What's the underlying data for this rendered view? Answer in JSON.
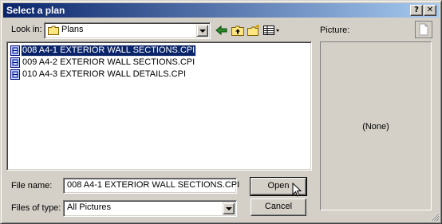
{
  "dialog": {
    "title": "Select a plan",
    "help_button": "?",
    "close_button": "✕"
  },
  "look_in": {
    "label": "Look in:",
    "value": "Plans"
  },
  "toolbar": {
    "icons": [
      "back-arrow-icon",
      "up-folder-icon",
      "new-folder-icon",
      "view-menu-icon"
    ]
  },
  "files": [
    {
      "name": "008 A4-1 EXTERIOR WALL SECTIONS.CPI",
      "selected": true
    },
    {
      "name": "009 A4-2 EXTERIOR WALL SECTIONS.CPI",
      "selected": false
    },
    {
      "name": "010 A4-3 EXTERIOR WALL DETAILS.CPI",
      "selected": false
    }
  ],
  "picture": {
    "label": "Picture:",
    "empty_text": "(None)"
  },
  "file_name": {
    "label": "File name:",
    "value": "008 A4-1 EXTERIOR WALL SECTIONS.CPI"
  },
  "files_of_type": {
    "label": "Files of type:",
    "value": "All Pictures"
  },
  "buttons": {
    "open": "Open",
    "cancel": "Cancel"
  },
  "colors": {
    "titlebar_start": "#0a246a",
    "titlebar_end": "#a6caf0",
    "selection": "#0a246a",
    "face": "#d4d0c8"
  }
}
